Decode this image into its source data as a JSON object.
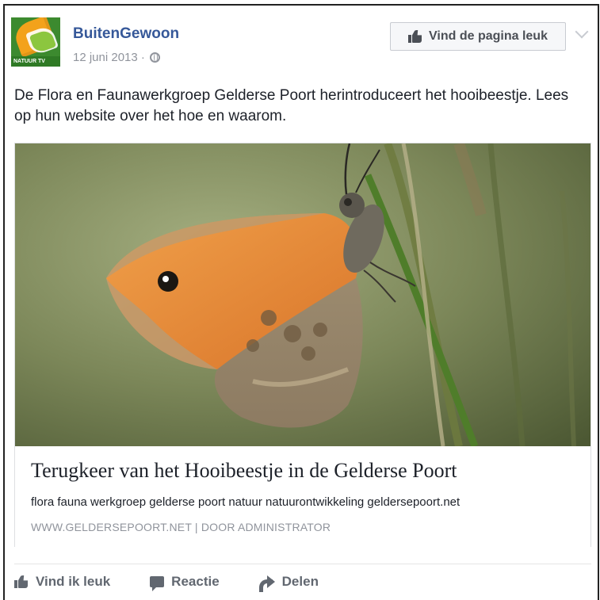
{
  "post": {
    "page_name": "BuitenGewoon",
    "date": "12 juni 2013 ·",
    "logo_tag": "NATUUR TV",
    "like_page_label": "Vind de pagina leuk",
    "text": "De Flora en Faunawerkgroep Gelderse Poort herintroduceert het hooibeestje. Lees op hun website over het hoe en waarom."
  },
  "card": {
    "image_icon": "butterfly-photo",
    "title": "Terugkeer van het Hooibeestje in de Gelderse Poort",
    "description": "flora fauna werkgroep gelderse poort natuur natuurontwikkeling geldersepoort.net",
    "source": "WWW.GELDERSEPOORT.NET  |  DOOR ADMINISTRATOR"
  },
  "actions": {
    "like": "Vind ik leuk",
    "comment": "Reactie",
    "share": "Delen"
  },
  "colors": {
    "link_blue": "#365899",
    "meta_gray": "#90949c",
    "action_gray": "#616770",
    "butterfly_orange": "#e8862f"
  },
  "icons": [
    "globe-icon",
    "thumbs-up-icon",
    "chevron-down-icon",
    "comment-icon",
    "share-arrow-icon"
  ]
}
